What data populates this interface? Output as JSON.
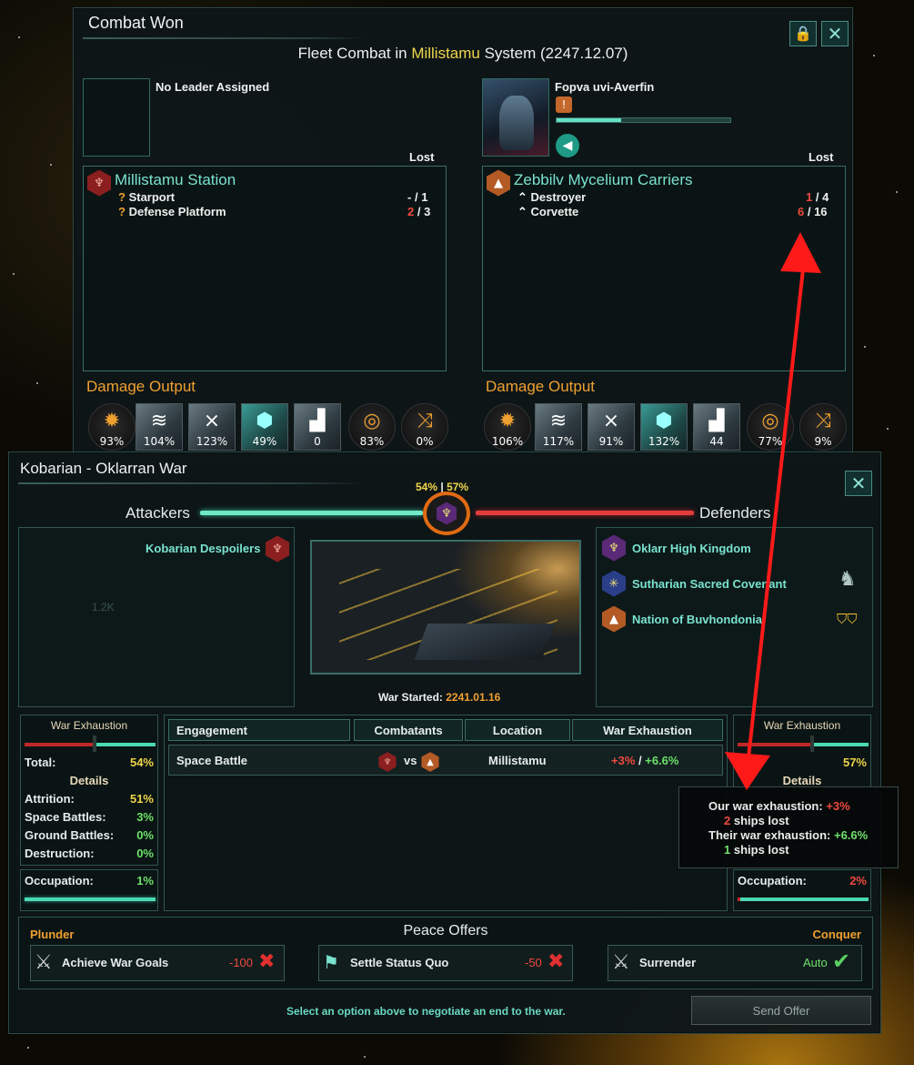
{
  "combat": {
    "title": "Combat Won",
    "heading_pre": "Fleet Combat in ",
    "heading_system": "Millistamu",
    "heading_post": " System (2247.12.07)",
    "left": {
      "leader": "No Leader Assigned",
      "lost_label": "Lost",
      "name": "Millistamu Station",
      "ships": [
        {
          "name": "Starport",
          "lost": "-",
          "total": "1"
        },
        {
          "name": "Defense Platform",
          "lost": "2",
          "total": "3"
        }
      ],
      "damage_label": "Damage Output",
      "damage": [
        "93%",
        "104%",
        "123%",
        "49%",
        "0",
        "83%",
        "0%"
      ]
    },
    "right": {
      "leader": "Fopva uvi-Averfin",
      "lost_label": "Lost",
      "name": "Zebbilv Mycelium Carriers",
      "ships": [
        {
          "name": "Destroyer",
          "lost": "1",
          "total": "4"
        },
        {
          "name": "Corvette",
          "lost": "6",
          "total": "16"
        }
      ],
      "damage_label": "Damage Output",
      "damage": [
        "106%",
        "117%",
        "91%",
        "132%",
        "44",
        "77%",
        "9%"
      ]
    }
  },
  "war": {
    "title": "Kobarian - Oklarran War",
    "score_left": "54%",
    "score_sep": "|",
    "score_right": "57%",
    "attackers_label": "Attackers",
    "defenders_label": "Defenders",
    "attackers": [
      "Kobarian Despoilers"
    ],
    "defenders": [
      "Oklarr High Kingdom",
      "Sutharian Sacred Covenant",
      "Nation of Buvhondonia"
    ],
    "faded_value": "1.2K",
    "started_label": "War Started:",
    "started_date": "2241.01.16",
    "left_ex": {
      "title": "War Exhaustion",
      "total_label": "Total:",
      "total": "54%",
      "details_label": "Details",
      "rows": [
        {
          "label": "Attrition:",
          "value": "51%"
        },
        {
          "label": "Space Battles:",
          "value": "3%"
        },
        {
          "label": "Ground Battles:",
          "value": "0%"
        },
        {
          "label": "Destruction:",
          "value": "0%"
        }
      ],
      "occupation_label": "Occupation:",
      "occupation": "1%"
    },
    "right_ex": {
      "title": "War Exhaustion",
      "total": "57%",
      "details_label": "Details",
      "occupation_label": "Occupation:",
      "occupation": "2%"
    },
    "table": {
      "headers": [
        "Engagement",
        "Combatants",
        "Location",
        "War Exhaustion"
      ],
      "row": {
        "engagement": "Space Battle",
        "vs": "vs",
        "location": "Millistamu",
        "ex_a": "+3%",
        "ex_sep": " / ",
        "ex_b": "+6.6%"
      }
    },
    "tooltip": {
      "our_label": "Our war exhaustion: ",
      "our_value": "+3%",
      "our_ships_n": "2",
      "ships_lost": " ships lost",
      "their_label": "Their war exhaustion: ",
      "their_value": "+6.6%",
      "their_ships_n": "1"
    },
    "peace": {
      "title": "Peace Offers",
      "plunder": "Plunder",
      "conquer": "Conquer",
      "offers": [
        {
          "label": "Achieve War Goals",
          "value": "-100"
        },
        {
          "label": "Settle Status Quo",
          "value": "-50"
        },
        {
          "label": "Surrender",
          "value": "Auto"
        }
      ],
      "hint": "Select an option above to negotiate an end to the war.",
      "send": "Send Offer"
    }
  }
}
